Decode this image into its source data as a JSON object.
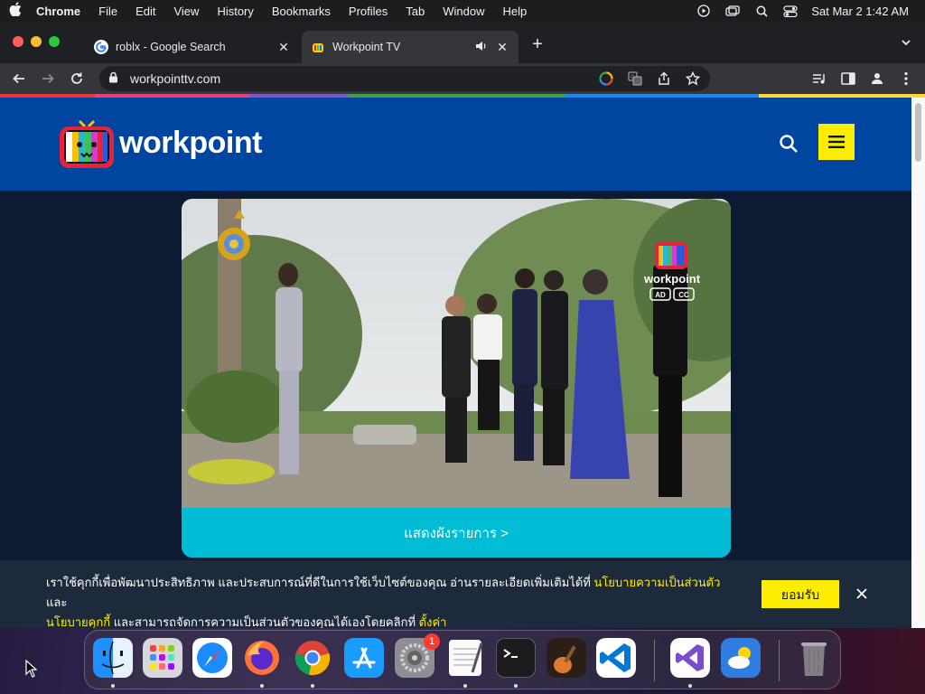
{
  "menubar": {
    "app": "Chrome",
    "items": [
      "File",
      "Edit",
      "View",
      "History",
      "Bookmarks",
      "Profiles",
      "Tab",
      "Window",
      "Help"
    ],
    "clock": "Sat Mar 2  1:42 AM"
  },
  "tabs": [
    {
      "title": "roblx - Google Search",
      "favicon": "google-icon"
    },
    {
      "title": "Workpoint TV",
      "favicon": "workpoint-icon"
    }
  ],
  "omnibox": {
    "url": "workpointtv.com"
  },
  "site": {
    "logo_text": "workpoint",
    "cta": "แสดงผังรายการ >",
    "photo_watermark": "workpoint",
    "photo_badges": [
      "AD",
      "CC"
    ]
  },
  "cookie": {
    "text_1": "เราใช้คุกกี้เพื่อพัฒนาประสิทธิภาพ และประสบการณ์ที่ดีในการใช้เว็บไซต์ของคุณ อ่านรายละเอียดเพิ่มเติมได้ที่ ",
    "link_privacy": "นโยบายความเป็นส่วนตัว",
    "text_2": " และ ",
    "link_cookie": "นโยบายคุกกี้",
    "text_3": " และสามารถจัดการความเป็นส่วนตัวของคุณได้เองโดยคลิกที่ ",
    "link_settings": "ตั้งค่า",
    "accept": "ยอมรับ"
  },
  "dock": {
    "apps": [
      "Finder",
      "Launchpad",
      "Safari",
      "Firefox",
      "Chrome",
      "App Store",
      "System Settings",
      "TextEdit",
      "Terminal",
      "GarageBand",
      "Visual Studio Code",
      "Visual Studio",
      "Weather",
      "Trash"
    ],
    "settings_badge": "1"
  },
  "colors": {
    "site_header": "#0046a0",
    "site_bg": "#0d1b32",
    "accent_yellow": "#ffed00",
    "cta_cyan": "#00bcd4"
  }
}
